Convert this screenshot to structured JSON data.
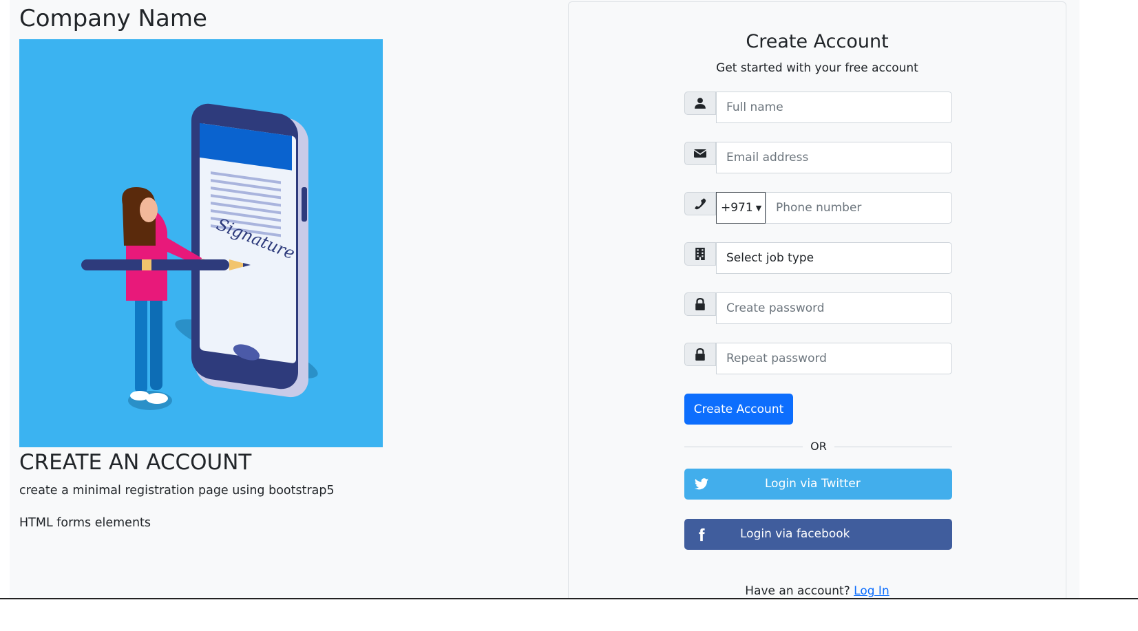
{
  "left": {
    "company_name": "Company Name",
    "heading": "CREATE AN ACCOUNT",
    "description": "create a minimal registration page using bootstrap5",
    "note": "HTML forms elements",
    "hero_signature_text": "Signature"
  },
  "form": {
    "title": "Create Account",
    "subtitle": "Get started with your free account",
    "full_name_placeholder": "Full name",
    "email_placeholder": "Email address",
    "phone_code": "+971",
    "phone_placeholder": "Phone number",
    "job_type": "Select job type",
    "password_placeholder": "Create password",
    "repeat_password_placeholder": "Repeat password",
    "submit_label": "Create Account",
    "or_text": "OR",
    "twitter_label": "Login via Twitter",
    "facebook_label": "Login via facebook",
    "have_account_text": "Have an account?",
    "login_link": "Log In"
  },
  "icons": {
    "full_name": "user-icon",
    "email": "envelope-icon",
    "phone": "phone-icon",
    "job": "building-icon",
    "password": "lock-icon",
    "repeat_password": "lock-icon",
    "twitter": "twitter-icon",
    "facebook": "facebook-icon"
  },
  "colors": {
    "primary": "#0d6efd",
    "twitter": "#42aeec",
    "facebook": "#405d9d",
    "hero_background": "#3bb3f1"
  }
}
